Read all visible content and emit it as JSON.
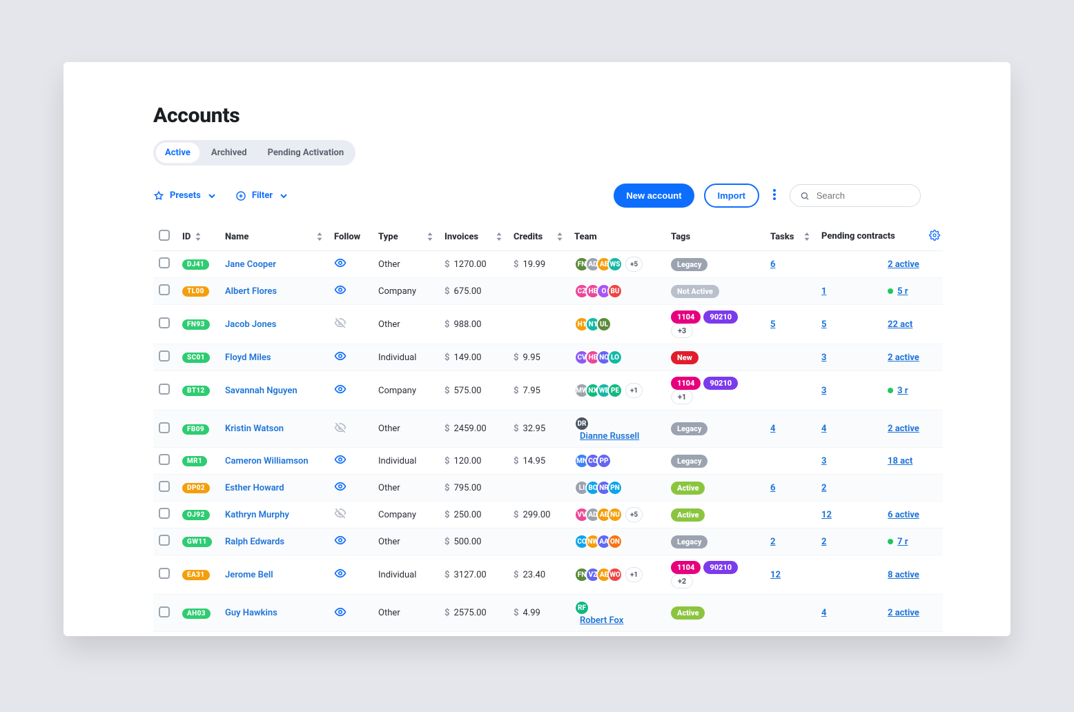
{
  "page": {
    "title": "Accounts"
  },
  "tabs": [
    {
      "label": "Active",
      "active": true
    },
    {
      "label": "Archived",
      "active": false
    },
    {
      "label": "Pending Activation",
      "active": false
    }
  ],
  "toolbar": {
    "presets_label": "Presets",
    "filter_label": "Filter",
    "new_account_label": "New account",
    "import_label": "Import",
    "search_placeholder": "Search"
  },
  "columns": {
    "id": "ID",
    "name": "Name",
    "follow": "Follow",
    "type": "Type",
    "invoices": "Invoices",
    "credits": "Credits",
    "team": "Team",
    "tags": "Tags",
    "tasks": "Tasks",
    "pending": "Pending contracts"
  },
  "currency": "$",
  "avatar_palette": [
    "#4b5563",
    "#f59e0b",
    "#10b981",
    "#8b5cf6",
    "#ef4444",
    "#3b82f6",
    "#a855f7",
    "#ec4899",
    "#14b8a6",
    "#22c55e",
    "#f97316",
    "#0ea5e9",
    "#6366f1",
    "#5b8a3a",
    "#9ca3af"
  ],
  "rows": [
    {
      "id": "DJ41",
      "id_color": "green",
      "name": "Jane Cooper",
      "follow": true,
      "type": "Other",
      "invoices": "1270.00",
      "credits": "19.99",
      "team": {
        "avatars": [
          "FN",
          "AD",
          "AE",
          "WS"
        ],
        "plus": "+5"
      },
      "tags": [
        {
          "t": "Legacy",
          "c": "gray"
        }
      ],
      "tasks": "6",
      "pending": "",
      "status": "2 active"
    },
    {
      "id": "TL00",
      "id_color": "orange",
      "name": "Albert Flores",
      "follow": true,
      "type": "Company",
      "invoices": "675.00",
      "credits": "",
      "team": {
        "avatars": [
          "CZ",
          "HE",
          "O",
          "BU"
        ]
      },
      "tags": [
        {
          "t": "Not Active",
          "c": "graylight"
        }
      ],
      "tasks": "",
      "pending": "1",
      "status": "5 r",
      "dot": true
    },
    {
      "id": "FN93",
      "id_color": "green",
      "name": "Jacob Jones",
      "follow": false,
      "type": "Other",
      "invoices": "988.00",
      "credits": "",
      "team": {
        "avatars": [
          "H1",
          "N1",
          "UL"
        ]
      },
      "tags": [
        {
          "t": "1104",
          "c": "pink"
        },
        {
          "t": "90210",
          "c": "purple"
        },
        {
          "t": "+3",
          "c": "count"
        }
      ],
      "tasks": "5",
      "pending": "5",
      "status": "22 act"
    },
    {
      "id": "SC01",
      "id_color": "green",
      "name": "Floyd Miles",
      "follow": true,
      "type": "Individual",
      "invoices": "149.00",
      "credits": "9.95",
      "team": {
        "avatars": [
          "CV",
          "HE",
          "NC",
          "LO"
        ]
      },
      "tags": [
        {
          "t": "New",
          "c": "red"
        }
      ],
      "tasks": "",
      "pending": "3",
      "status": "2 active"
    },
    {
      "id": "BT12",
      "id_color": "green",
      "name": "Savannah Nguyen",
      "follow": true,
      "type": "Company",
      "invoices": "575.00",
      "credits": "7.95",
      "team": {
        "avatars": [
          "MW",
          "NX",
          "WE",
          "PE"
        ],
        "plus": "+1"
      },
      "tags": [
        {
          "t": "1104",
          "c": "pink"
        },
        {
          "t": "90210",
          "c": "purple"
        },
        {
          "t": "+1",
          "c": "count"
        }
      ],
      "tasks": "",
      "pending": "3",
      "status": "3 r",
      "dot": true
    },
    {
      "id": "FB09",
      "id_color": "green",
      "name": "Kristin Watson",
      "follow": false,
      "type": "Other",
      "invoices": "2459.00",
      "credits": "32.95",
      "team": {
        "avatars": [
          "DR"
        ],
        "name": "Dianne Russell"
      },
      "tags": [
        {
          "t": "Legacy",
          "c": "gray"
        }
      ],
      "tasks": "4",
      "pending": "4",
      "status": "2 active"
    },
    {
      "id": "MR1",
      "id_color": "green",
      "name": "Cameron Williamson",
      "follow": true,
      "type": "Individual",
      "invoices": "120.00",
      "credits": "14.95",
      "team": {
        "avatars": [
          "MN",
          "CO",
          "PP"
        ]
      },
      "tags": [
        {
          "t": "Legacy",
          "c": "gray"
        }
      ],
      "tasks": "",
      "pending": "3",
      "status": "18 act"
    },
    {
      "id": "DP02",
      "id_color": "orange",
      "name": "Esther Howard",
      "follow": true,
      "type": "Other",
      "invoices": "795.00",
      "credits": "",
      "team": {
        "avatars": [
          "LI",
          "BO",
          "NR",
          "PN"
        ]
      },
      "tags": [
        {
          "t": "Active",
          "c": "green"
        }
      ],
      "tasks": "6",
      "pending": "2",
      "status": ""
    },
    {
      "id": "OJ92",
      "id_color": "green",
      "name": "Kathryn Murphy",
      "follow": false,
      "type": "Company",
      "invoices": "250.00",
      "credits": "299.00",
      "team": {
        "avatars": [
          "VV",
          "AD",
          "AE",
          "NU"
        ],
        "plus": "+5"
      },
      "tags": [
        {
          "t": "Active",
          "c": "green"
        }
      ],
      "tasks": "",
      "pending": "12",
      "status": "6 active"
    },
    {
      "id": "GW11",
      "id_color": "green",
      "name": "Ralph Edwards",
      "follow": true,
      "type": "Other",
      "invoices": "500.00",
      "credits": "",
      "team": {
        "avatars": [
          "CO",
          "NW",
          "AA",
          "ON"
        ]
      },
      "tags": [
        {
          "t": "Legacy",
          "c": "gray"
        }
      ],
      "tasks": "2",
      "pending": "2",
      "status": "7 r",
      "dot": true
    },
    {
      "id": "EA31",
      "id_color": "orange",
      "name": "Jerome Bell",
      "follow": true,
      "type": "Individual",
      "invoices": "3127.00",
      "credits": "23.40",
      "team": {
        "avatars": [
          "FN",
          "VZ",
          "AE",
          "WO"
        ],
        "plus": "+1"
      },
      "tags": [
        {
          "t": "1104",
          "c": "pink"
        },
        {
          "t": "90210",
          "c": "purple"
        },
        {
          "t": "+2",
          "c": "count"
        }
      ],
      "tasks": "12",
      "pending": "",
      "status": "8 active"
    },
    {
      "id": "AH03",
      "id_color": "green",
      "name": "Guy Hawkins",
      "follow": true,
      "type": "Other",
      "invoices": "2575.00",
      "credits": "4.99",
      "team": {
        "avatars": [
          "RF"
        ],
        "name": "Robert Fox"
      },
      "tags": [
        {
          "t": "Active",
          "c": "green"
        }
      ],
      "tasks": "",
      "pending": "4",
      "status": "2 active"
    }
  ]
}
